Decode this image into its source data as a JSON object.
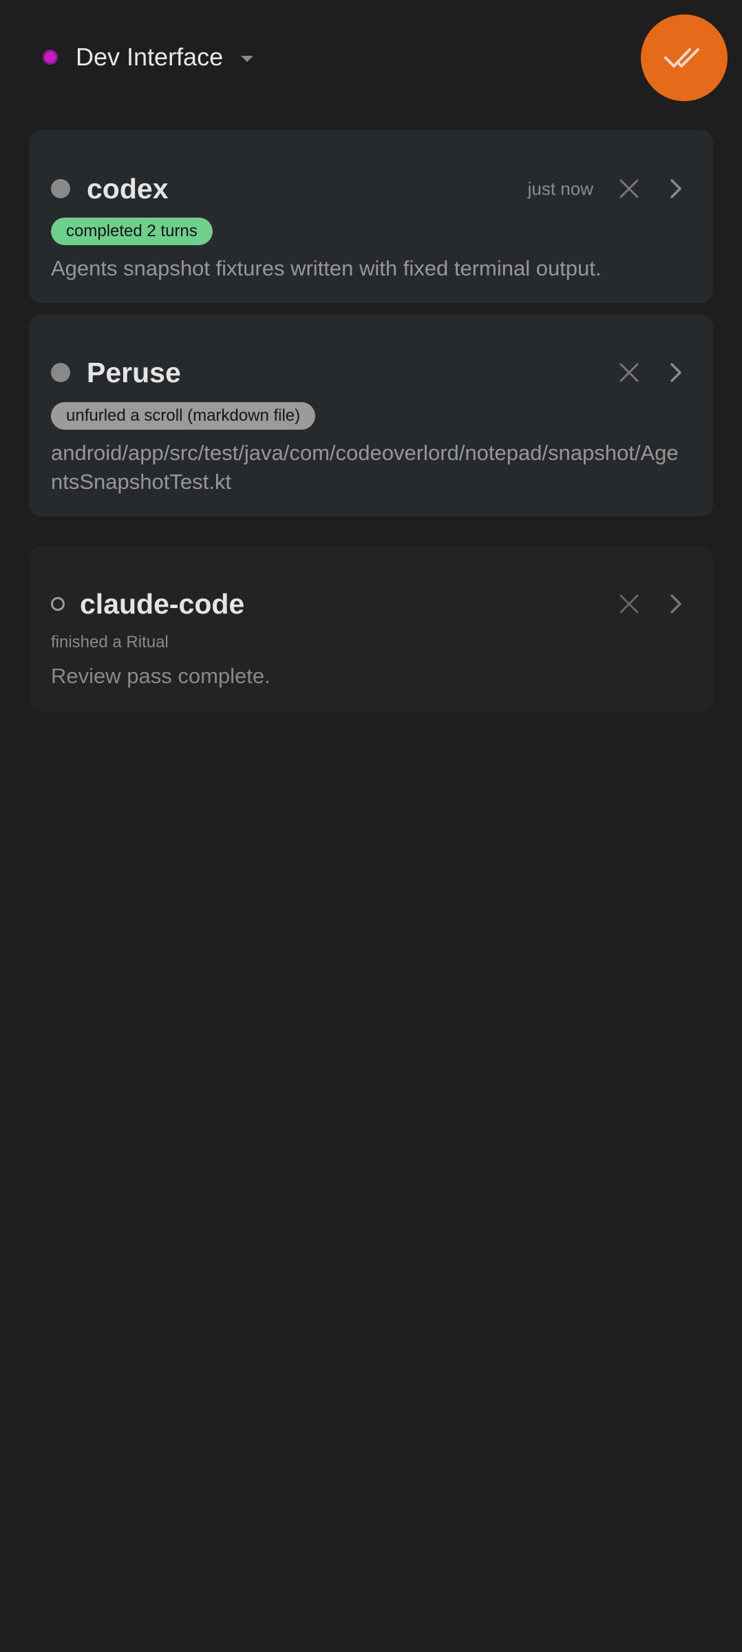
{
  "header": {
    "interface_name": "Dev Interface",
    "status_color": "#c81ec8",
    "fab_icon": "double-check-icon",
    "fab_color": "#e56a1a"
  },
  "agents": [
    {
      "name": "codex",
      "time": "just now",
      "badge": "completed 2 turns",
      "description": "Agents snapshot fixtures written with fixed terminal output."
    },
    {
      "name": "Peruse",
      "badge": "unfurled a scroll (markdown file)",
      "description": "android/app/src/test/java/com/codeoverlord/notepad/snapshot/AgentsSnapshotTest.kt"
    },
    {
      "name": "claude-code",
      "subline": "finished a Ritual",
      "description": "Review pass complete."
    }
  ]
}
